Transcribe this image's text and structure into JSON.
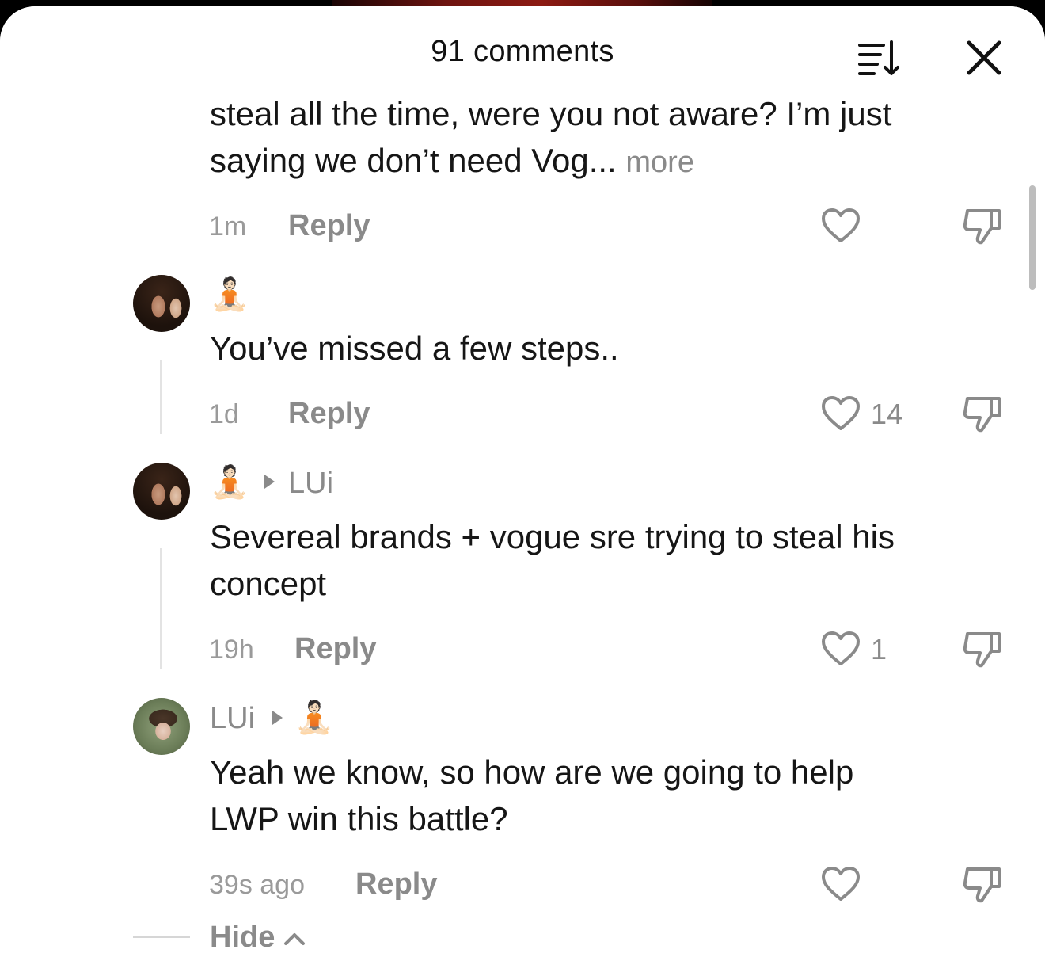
{
  "header": {
    "title": "91 comments",
    "sort_icon": "sort-list-icon",
    "close_icon": "close-icon"
  },
  "comments": [
    {
      "text_line1": "steal all the time, were you not aware? I’m just",
      "text_line2": "saying we don’t need Vog...",
      "more": "more",
      "time": "1m",
      "reply": "Reply",
      "likes": ""
    },
    {
      "user": "🧘🏻",
      "text_line1": "You’ve missed a few steps..",
      "time": "1d",
      "reply": "Reply",
      "likes": "14"
    },
    {
      "user": "🧘🏻",
      "reply_to": "LUi",
      "text_line1": "Severeal brands + vogue sre trying to steal his",
      "text_line2": "concept",
      "time": "19h",
      "reply": "Reply",
      "likes": "1"
    },
    {
      "user": "LUi",
      "reply_to": "🧘🏻",
      "text_line1": "Yeah we know, so how are we going to help",
      "text_line2": "LWP win this battle?",
      "time": "39s ago",
      "reply": "Reply",
      "likes": ""
    }
  ],
  "footer": {
    "hide_label": "Hide"
  },
  "colors": {
    "text": "#161616",
    "muted": "#8a8a8a",
    "background": "#ffffff"
  }
}
